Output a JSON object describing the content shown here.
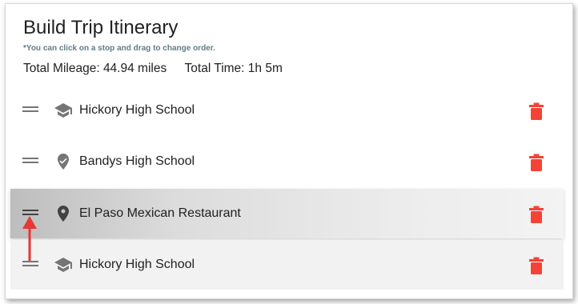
{
  "itinerary": {
    "title": "Build Trip Itinerary",
    "hint": "*You can click on a stop and drag to change order.",
    "total_mileage_label": "Total Mileage: 44.94 miles",
    "total_time_label": "Total Time: 1h 5m"
  },
  "stops": [
    {
      "name": "Hickory High School",
      "icon": "school-icon"
    },
    {
      "name": "Bandys High School",
      "icon": "place-check-icon"
    },
    {
      "name": "El Paso Mexican Restaurant",
      "icon": "place-icon"
    },
    {
      "name": "Hickory High School",
      "icon": "school-icon"
    }
  ],
  "colors": {
    "delete": "#f44336",
    "icon": "#757575",
    "hint": "#607d8b",
    "annotation_arrow": "#e53935"
  }
}
